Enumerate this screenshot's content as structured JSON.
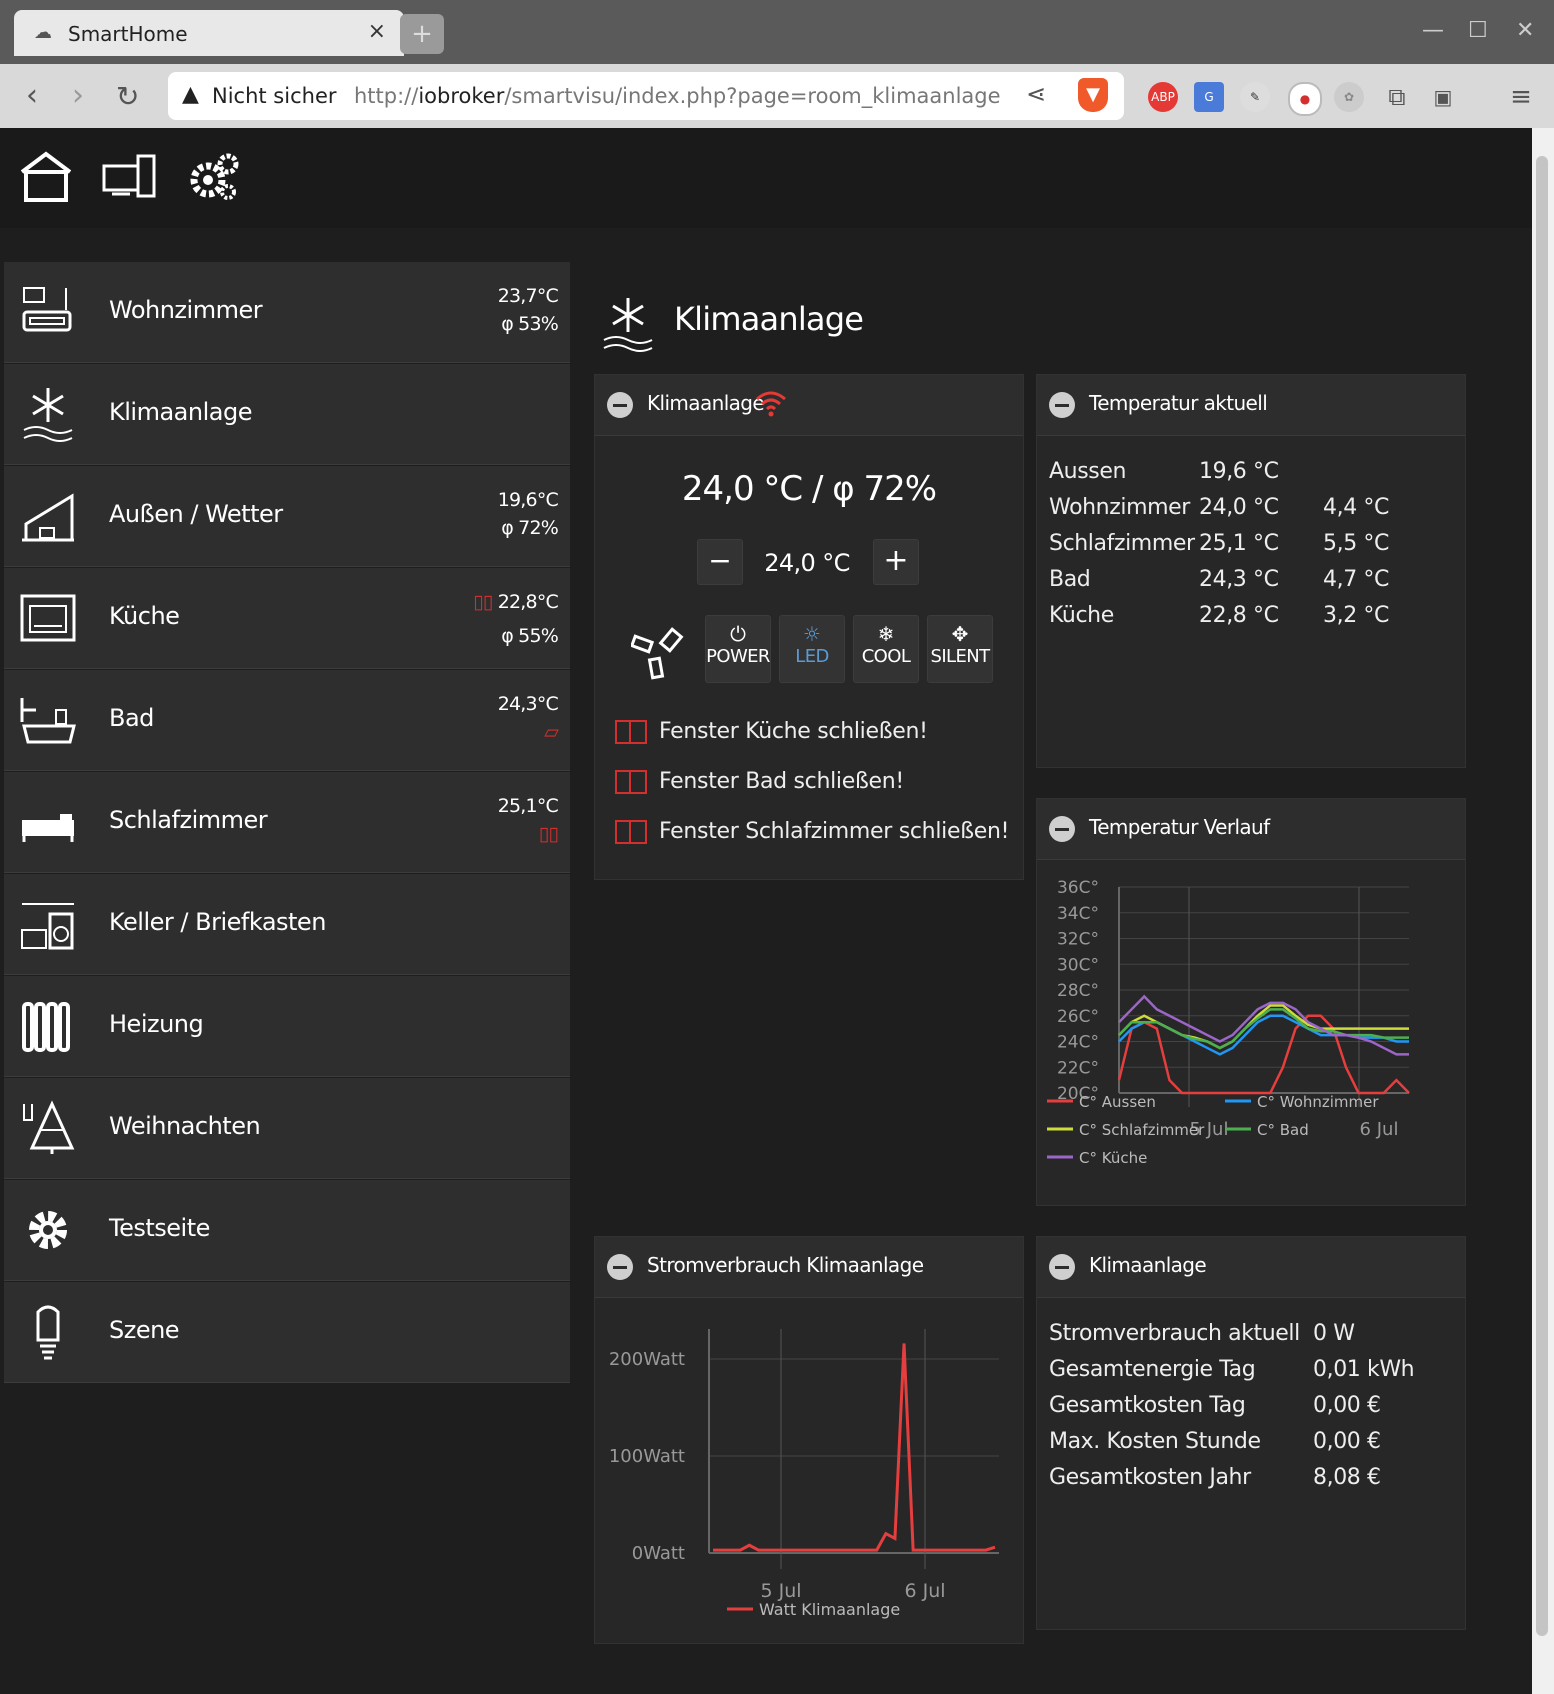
{
  "browser": {
    "tab_title": "SmartHome",
    "tab_close": "×",
    "new_tab": "+",
    "security_label": "Nicht sicher",
    "url_prefix": "http://",
    "url_host": "iobroker",
    "url_path": "/smartvisu/index.php?page=room_klimaanlage",
    "ext_abp": "ABP"
  },
  "sidebar": {
    "rooms": [
      {
        "name": "Wohnzimmer",
        "info1": "23,7°C",
        "info2": "φ 53%"
      },
      {
        "name": "Klimaanlage",
        "info1": "",
        "info2": ""
      },
      {
        "name": "Außen / Wetter",
        "info1": "19,6°C",
        "info2": "φ 72%"
      },
      {
        "name": "Küche",
        "info1": "22,8°C",
        "info2": "φ 55%"
      },
      {
        "name": "Bad",
        "info1": "24,3°C",
        "info2": ""
      },
      {
        "name": "Schlafzimmer",
        "info1": "25,1°C",
        "info2": ""
      },
      {
        "name": "Keller / Briefkasten",
        "info1": "",
        "info2": ""
      },
      {
        "name": "Heizung",
        "info1": "",
        "info2": ""
      },
      {
        "name": "Weihnachten",
        "info1": "",
        "info2": ""
      },
      {
        "name": "Testseite",
        "info1": "",
        "info2": ""
      },
      {
        "name": "Szene",
        "info1": "",
        "info2": ""
      }
    ]
  },
  "main": {
    "page_title": "Klimaanlage",
    "ac_panel": {
      "title": "Klimaanlage",
      "reading": "24,0 °C / φ 72%",
      "setpoint": "24,0 °C",
      "buttons": [
        "POWER",
        "LED",
        "COOL",
        "SILENT"
      ],
      "warnings": [
        "Fenster Küche schließen!",
        "Fenster Bad schließen!",
        "Fenster Schlafzimmer schließen!"
      ]
    },
    "temp_panel": {
      "title": "Temperatur aktuell",
      "rows": [
        {
          "room": "Aussen",
          "temp": "19,6 °C",
          "diff": ""
        },
        {
          "room": "Wohnzimmer",
          "temp": "24,0 °C",
          "diff": "4,4 °C"
        },
        {
          "room": "Schlafzimmer",
          "temp": "25,1 °C",
          "diff": "5,5 °C"
        },
        {
          "room": "Bad",
          "temp": "24,3 °C",
          "diff": "4,7 °C"
        },
        {
          "room": "Küche",
          "temp": "22,8 °C",
          "diff": "3,2 °C"
        }
      ]
    },
    "history_panel": {
      "title": "Temperatur Verlauf"
    },
    "power_panel": {
      "title": "Stromverbrauch Klimaanlage"
    },
    "stats_panel": {
      "title": "Klimaanlage",
      "rows": [
        {
          "label": "Stromverbrauch aktuell",
          "value": "0 W"
        },
        {
          "label": "Gesamtenergie Tag",
          "value": "0,01 kWh"
        },
        {
          "label": "Gesamtkosten Tag",
          "value": "0,00 €"
        },
        {
          "label": "Max. Kosten Stunde",
          "value": "0,00 €"
        },
        {
          "label": "Gesamtkosten Jahr",
          "value": "8,08 €"
        }
      ]
    }
  },
  "chart_data": [
    {
      "type": "line",
      "yticks": [
        "36C°",
        "34C°",
        "32C°",
        "30C°",
        "28C°",
        "26C°",
        "24C°",
        "22C°",
        "20C°"
      ],
      "ylim": [
        20,
        36
      ],
      "xticks": [
        "5 Jul",
        "6 Jul"
      ],
      "series": [
        {
          "name": "C° Aussen",
          "color": "#e53e3e",
          "values": [
            21,
            25,
            25.5,
            25,
            21,
            20,
            20,
            20,
            20,
            20,
            20,
            20,
            20,
            22,
            25,
            26,
            26,
            25,
            22,
            20,
            20,
            20,
            21,
            20
          ]
        },
        {
          "name": "C° Wohnzimmer",
          "color": "#2196f3",
          "values": [
            24,
            25,
            25.5,
            25.5,
            25,
            24.5,
            24,
            23.5,
            23,
            23.5,
            24.5,
            25.5,
            26,
            26,
            25.5,
            25,
            24.5,
            24.5,
            24.5,
            24.3,
            24.3,
            24.3,
            24,
            24
          ]
        },
        {
          "name": "C° Schlafzimmer",
          "color": "#cddc39",
          "values": [
            24.5,
            25.5,
            26,
            25.5,
            25,
            24.5,
            24.3,
            24,
            23.5,
            24,
            25,
            26,
            26.8,
            26.8,
            26,
            25.3,
            25,
            25,
            25,
            25,
            25,
            25,
            25,
            25
          ]
        },
        {
          "name": "C° Bad",
          "color": "#4caf50",
          "values": [
            24.5,
            25.5,
            25.5,
            25.5,
            25,
            24.5,
            24.2,
            24,
            23.5,
            24,
            25,
            25.8,
            26.5,
            26.5,
            25.8,
            25,
            24.8,
            24.8,
            24.5,
            24.5,
            24.5,
            24.3,
            24.3,
            24.3
          ]
        },
        {
          "name": "C° Küche",
          "color": "#9c66c9",
          "values": [
            25.5,
            26.5,
            27.5,
            26.5,
            26,
            25.5,
            25,
            24.5,
            24,
            24.5,
            25.5,
            26.5,
            27,
            27,
            26.5,
            25.5,
            25,
            24.5,
            24.5,
            24.3,
            24,
            23.5,
            23,
            23
          ]
        }
      ]
    },
    {
      "type": "line",
      "yticks": [
        "200Watt",
        "100Watt",
        "0Watt"
      ],
      "ylim": [
        0,
        200
      ],
      "xticks": [
        "5 Jul",
        "6 Jul"
      ],
      "series": [
        {
          "name": "Watt Klimaanlage",
          "color": "#e53e3e",
          "values": [
            3,
            3,
            3,
            3,
            8,
            3,
            3,
            3,
            3,
            3,
            3,
            3,
            3,
            3,
            3,
            3,
            3,
            3,
            3,
            20,
            15,
            230,
            3,
            3,
            3,
            3,
            3,
            3,
            3,
            3,
            3,
            6
          ]
        }
      ]
    }
  ]
}
